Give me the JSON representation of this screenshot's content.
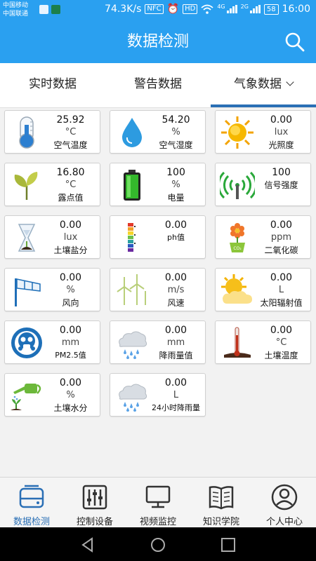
{
  "status_bar": {
    "carrier_1": "中国移动",
    "carrier_2": "中国联通",
    "net_speed": "74.3K/s",
    "nfc": "NFC",
    "hd": "HD",
    "gen_1": "4G",
    "gen_2": "2G",
    "battery": "58",
    "time": "16:00"
  },
  "header": {
    "title": "数据检测",
    "search_icon": "search-icon"
  },
  "tabs": [
    {
      "label": "实时数据",
      "active": false
    },
    {
      "label": "警告数据",
      "active": false
    },
    {
      "label": "气象数据",
      "active": true
    }
  ],
  "cards": [
    {
      "value": "25.92",
      "unit": "°C",
      "label": "空气温度",
      "icon": "thermometer-icon"
    },
    {
      "value": "54.20",
      "unit": "%",
      "label": "空气湿度",
      "icon": "water-drop-icon"
    },
    {
      "value": "0.00",
      "unit": "lux",
      "label": "光照度",
      "icon": "sun-icon"
    },
    {
      "value": "16.80",
      "unit": "°C",
      "label": "露点值",
      "icon": "leaf-icon"
    },
    {
      "value": "100",
      "unit": "%",
      "label": "电量",
      "icon": "battery-icon"
    },
    {
      "value": "100",
      "unit": "",
      "label": "信号强度",
      "icon": "signal-icon"
    },
    {
      "value": "0.00",
      "unit": "lux",
      "label": "土壤盐分",
      "icon": "hourglass-icon"
    },
    {
      "value": "0.00",
      "unit": "",
      "label": "ph值",
      "icon": "ph-scale-icon"
    },
    {
      "value": "0.00",
      "unit": "ppm",
      "label": "二氧化碳",
      "icon": "co2-plant-icon"
    },
    {
      "value": "0.00",
      "unit": "%",
      "label": "风向",
      "icon": "windsock-icon"
    },
    {
      "value": "0.00",
      "unit": "m/s",
      "label": "风速",
      "icon": "wind-turbine-icon"
    },
    {
      "value": "0.00",
      "unit": "L",
      "label": "太阳辐射值",
      "icon": "solar-radiation-icon"
    },
    {
      "value": "0.00",
      "unit": "mm",
      "label": "PM2.5值",
      "icon": "gas-mask-icon"
    },
    {
      "value": "0.00",
      "unit": "mm",
      "label": "降雨量值",
      "icon": "rain-cloud-icon"
    },
    {
      "value": "0.00",
      "unit": "°C",
      "label": "土壤温度",
      "icon": "soil-thermometer-icon"
    },
    {
      "value": "0.00",
      "unit": "%",
      "label": "土壤水分",
      "icon": "watering-can-icon"
    },
    {
      "value": "0.00",
      "unit": "L",
      "label": "24小时降雨量",
      "icon": "rain-cloud-icon"
    }
  ],
  "bottom_nav": [
    {
      "label": "数据检测",
      "icon": "monitor-data-icon",
      "active": true
    },
    {
      "label": "控制设备",
      "icon": "sliders-icon",
      "active": false
    },
    {
      "label": "视频监控",
      "icon": "desktop-icon",
      "active": false
    },
    {
      "label": "知识学院",
      "icon": "book-icon",
      "active": false
    },
    {
      "label": "个人中心",
      "icon": "user-icon",
      "active": false
    }
  ],
  "colors": {
    "primary": "#2aa0f0",
    "active_tab": "#2a6fb5",
    "active_nav": "#2a6fb5"
  }
}
